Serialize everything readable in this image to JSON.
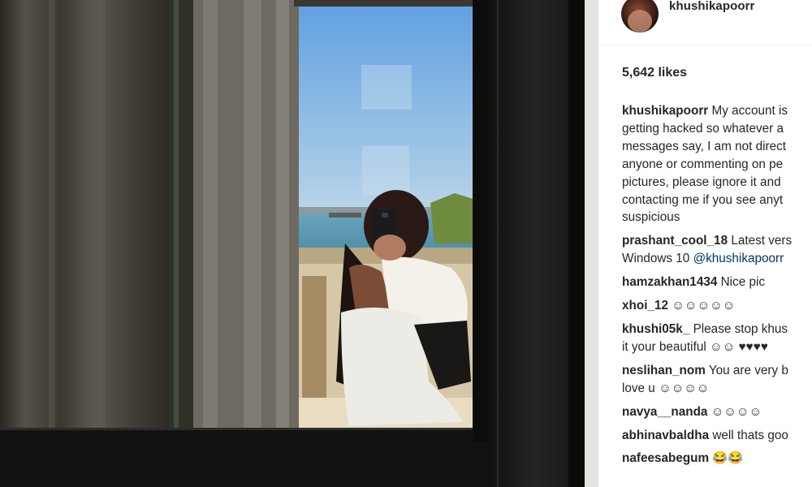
{
  "post": {
    "username": "khushikapoorr",
    "likes": "5,642 likes",
    "caption": {
      "author": "khushikapoorr",
      "lines": [
        "My account is",
        "getting hacked so whatever a",
        "messages say, I am not direct",
        "anyone or commenting on pe",
        "pictures, please ignore it and",
        "contacting me if you see anyt",
        "suspicious"
      ]
    },
    "comments": [
      {
        "author": "prashant_cool_18",
        "lines": [
          "Latest vers",
          "Windows 10 "
        ],
        "mention": "@khushikapoorr"
      },
      {
        "author": "hamzakhan1434",
        "lines": [
          "Nice pic"
        ]
      },
      {
        "author": "xhoi_12",
        "lines": [
          "☺☺☺☺☺"
        ]
      },
      {
        "author": "khushi05k_",
        "lines": [
          "Please stop khus",
          "it your beautiful ☺☺ ♥♥♥♥"
        ]
      },
      {
        "author": "neslihan_nom",
        "lines": [
          "You are very b",
          "love u ☺☺☺☺"
        ]
      },
      {
        "author": "navya__nanda",
        "lines": [
          "☺☺☺☺"
        ]
      },
      {
        "author": "abhinavbaldha",
        "lines": [
          "well thats goo"
        ]
      },
      {
        "author": "nafeesabegum",
        "lines": [
          "😂😂"
        ]
      }
    ]
  },
  "colors": {
    "text": "#262626",
    "mention": "#003569",
    "divider": "#efefef"
  }
}
